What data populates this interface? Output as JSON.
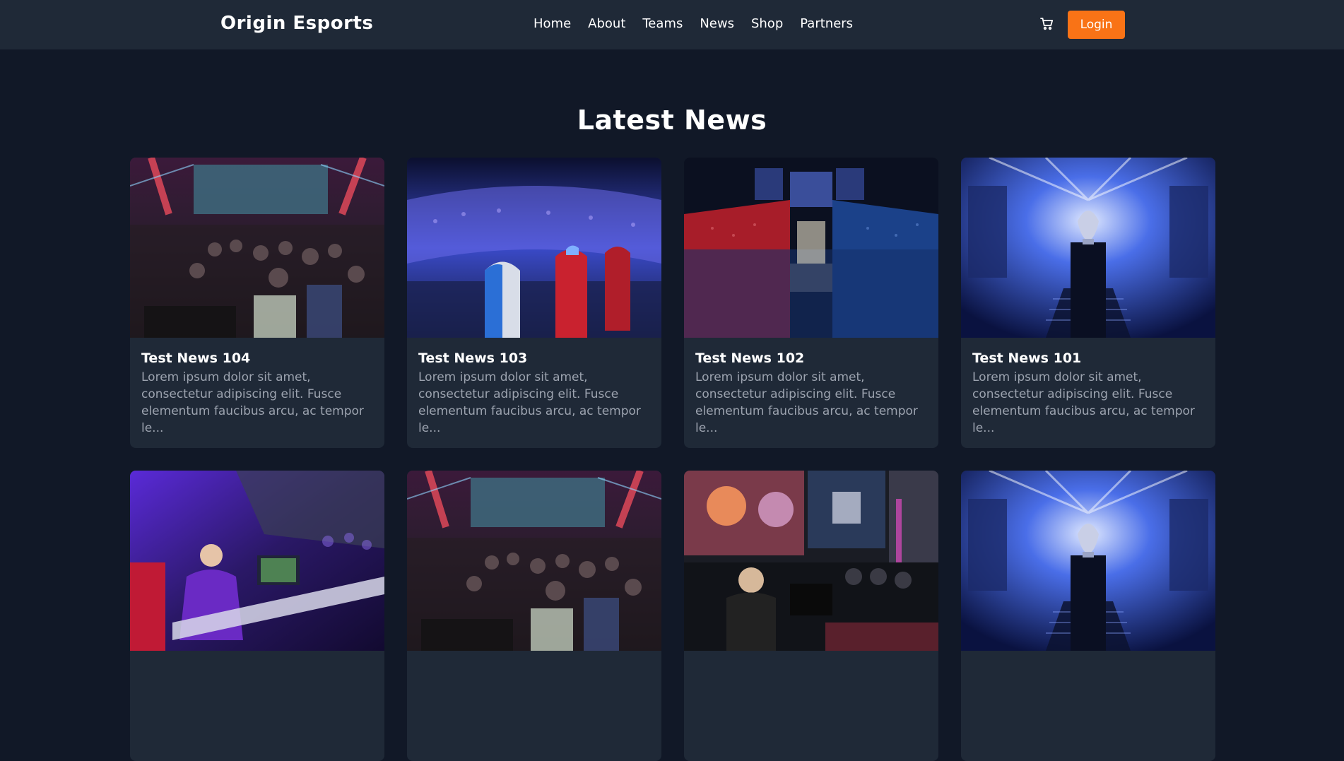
{
  "header": {
    "brand": "Origin Esports",
    "nav": [
      "Home",
      "About",
      "Teams",
      "News",
      "Shop",
      "Partners"
    ],
    "cart_icon": "shopping-cart-icon",
    "login_label": "Login",
    "accent": "#f97316"
  },
  "main": {
    "heading": "Latest News",
    "cards": [
      {
        "title": "Test News 104",
        "excerpt": "Lorem ipsum dolor sit amet, consectetur adipiscing elit. Fusce elementum faucibus arcu, ac tempor le...",
        "image": "esports-lan-crowd"
      },
      {
        "title": "Test News 103",
        "excerpt": "Lorem ipsum dolor sit amet, consectetur adipiscing elit. Fusce elementum faucibus arcu, ac tempor le...",
        "image": "esports-arena-players"
      },
      {
        "title": "Test News 102",
        "excerpt": "Lorem ipsum dolor sit amet, consectetur adipiscing elit. Fusce elementum faucibus arcu, ac tempor le...",
        "image": "esports-stadium"
      },
      {
        "title": "Test News 101",
        "excerpt": "Lorem ipsum dolor sit amet, consectetur adipiscing elit. Fusce elementum faucibus arcu, ac tempor le...",
        "image": "esports-trophy-stage"
      },
      {
        "title": "",
        "excerpt": "",
        "image": "esports-gamer-purple"
      },
      {
        "title": "",
        "excerpt": "",
        "image": "esports-lan-crowd"
      },
      {
        "title": "",
        "excerpt": "",
        "image": "esports-team-match"
      },
      {
        "title": "",
        "excerpt": "",
        "image": "esports-trophy-stage"
      }
    ]
  }
}
